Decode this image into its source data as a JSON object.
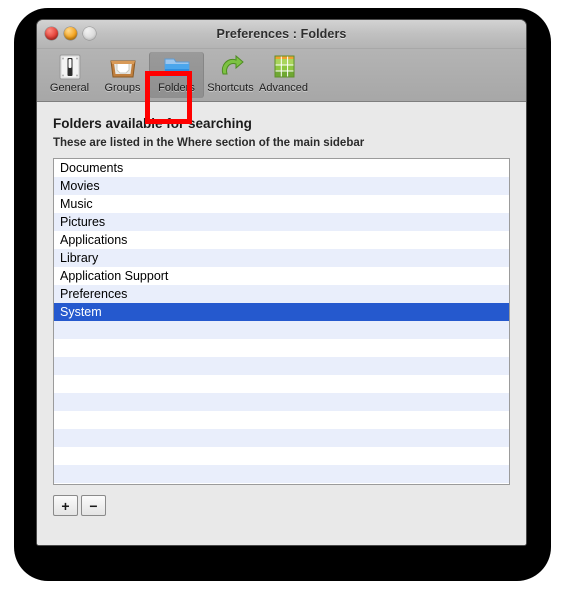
{
  "window": {
    "title": "Preferences : Folders",
    "controls": [
      {
        "name": "close",
        "label": "Close"
      },
      {
        "name": "minimize",
        "label": "Minimize"
      },
      {
        "name": "zoom",
        "label": "Zoom"
      }
    ]
  },
  "toolbar": {
    "items": [
      {
        "label": "General",
        "icon": "light-switch-icon",
        "selected": false
      },
      {
        "label": "Groups",
        "icon": "inbox-tray-icon",
        "selected": false
      },
      {
        "label": "Folders",
        "icon": "blue-folder-icon",
        "selected": true
      },
      {
        "label": "Shortcuts",
        "icon": "green-arrow-icon",
        "selected": false
      },
      {
        "label": "Advanced",
        "icon": "green-grid-icon",
        "selected": false
      }
    ]
  },
  "annotation": {
    "target": "Folders",
    "color": "#ff0000"
  },
  "content": {
    "heading": "Folders available for searching",
    "subheading": "These are listed in the Where section of the main sidebar",
    "folders": [
      "Documents",
      "Movies",
      "Music",
      "Pictures",
      "Applications",
      "Library",
      "Application Support",
      "Preferences",
      "System"
    ],
    "selected_index": 8,
    "empty_row_count": 9,
    "buttons": {
      "add_label": "+",
      "remove_label": "−"
    }
  },
  "colors": {
    "selection": "#2559ce",
    "row_alt": "#e9eefb",
    "annotation": "#ff0000",
    "window_bg": "#e9e9e9"
  }
}
